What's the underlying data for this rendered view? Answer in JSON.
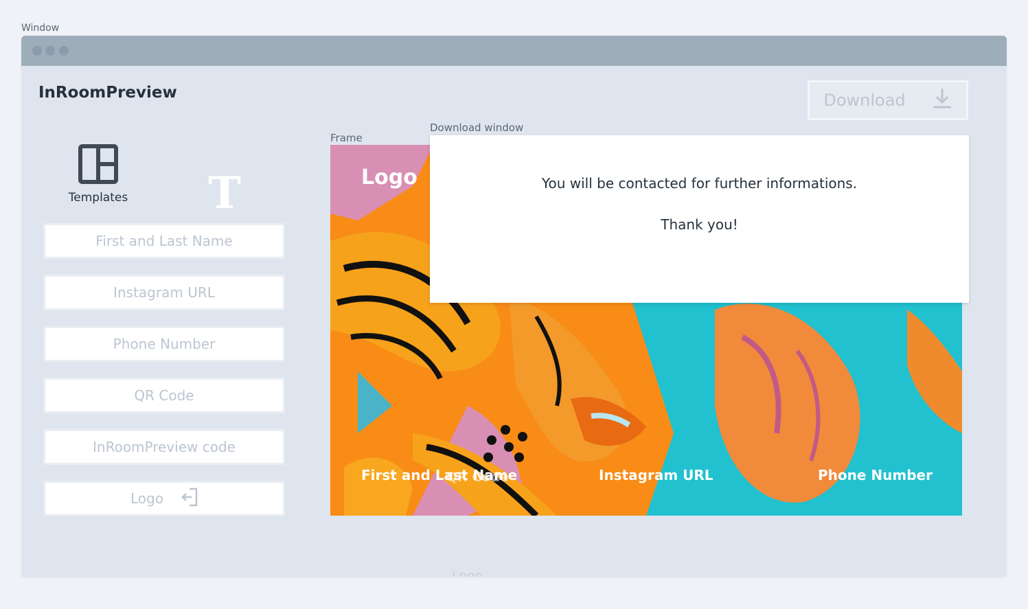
{
  "window_label": "Window",
  "app": {
    "title": "InRoomPreview"
  },
  "toolbar": {
    "download_label": "Download"
  },
  "tools": {
    "templates_label": "Templates",
    "text_tool_glyph": "T"
  },
  "fields": {
    "name_placeholder": "First and Last Name",
    "instagram_placeholder": "Instagram URL",
    "phone_placeholder": "Phone Number",
    "qr_placeholder": "QR Code",
    "code_placeholder": "InRoomPreview code",
    "logo_placeholder": "Logo"
  },
  "frame": {
    "label": "Frame",
    "logo_text": "Logo",
    "name_text": "First and Last Name",
    "qr_text": "QR Code",
    "instagram_text": "Instagram URL",
    "phone_text": "Phone Number"
  },
  "download_window": {
    "label": "Download window",
    "message": "You will be contacted for further informations.",
    "thanks": "Thank you!"
  },
  "ghost_logo_text": "Logo",
  "colors": {
    "window_bg": "#dfe5ee",
    "titlebar": "#9eadba",
    "placeholder_text": "#bcc5d0",
    "artwork_cyan": "#21c1cf",
    "artwork_orange": "#f88c16"
  },
  "icons": [
    "templates-icon",
    "text-tool-icon",
    "download-arrow-icon",
    "logo-upload-icon"
  ]
}
